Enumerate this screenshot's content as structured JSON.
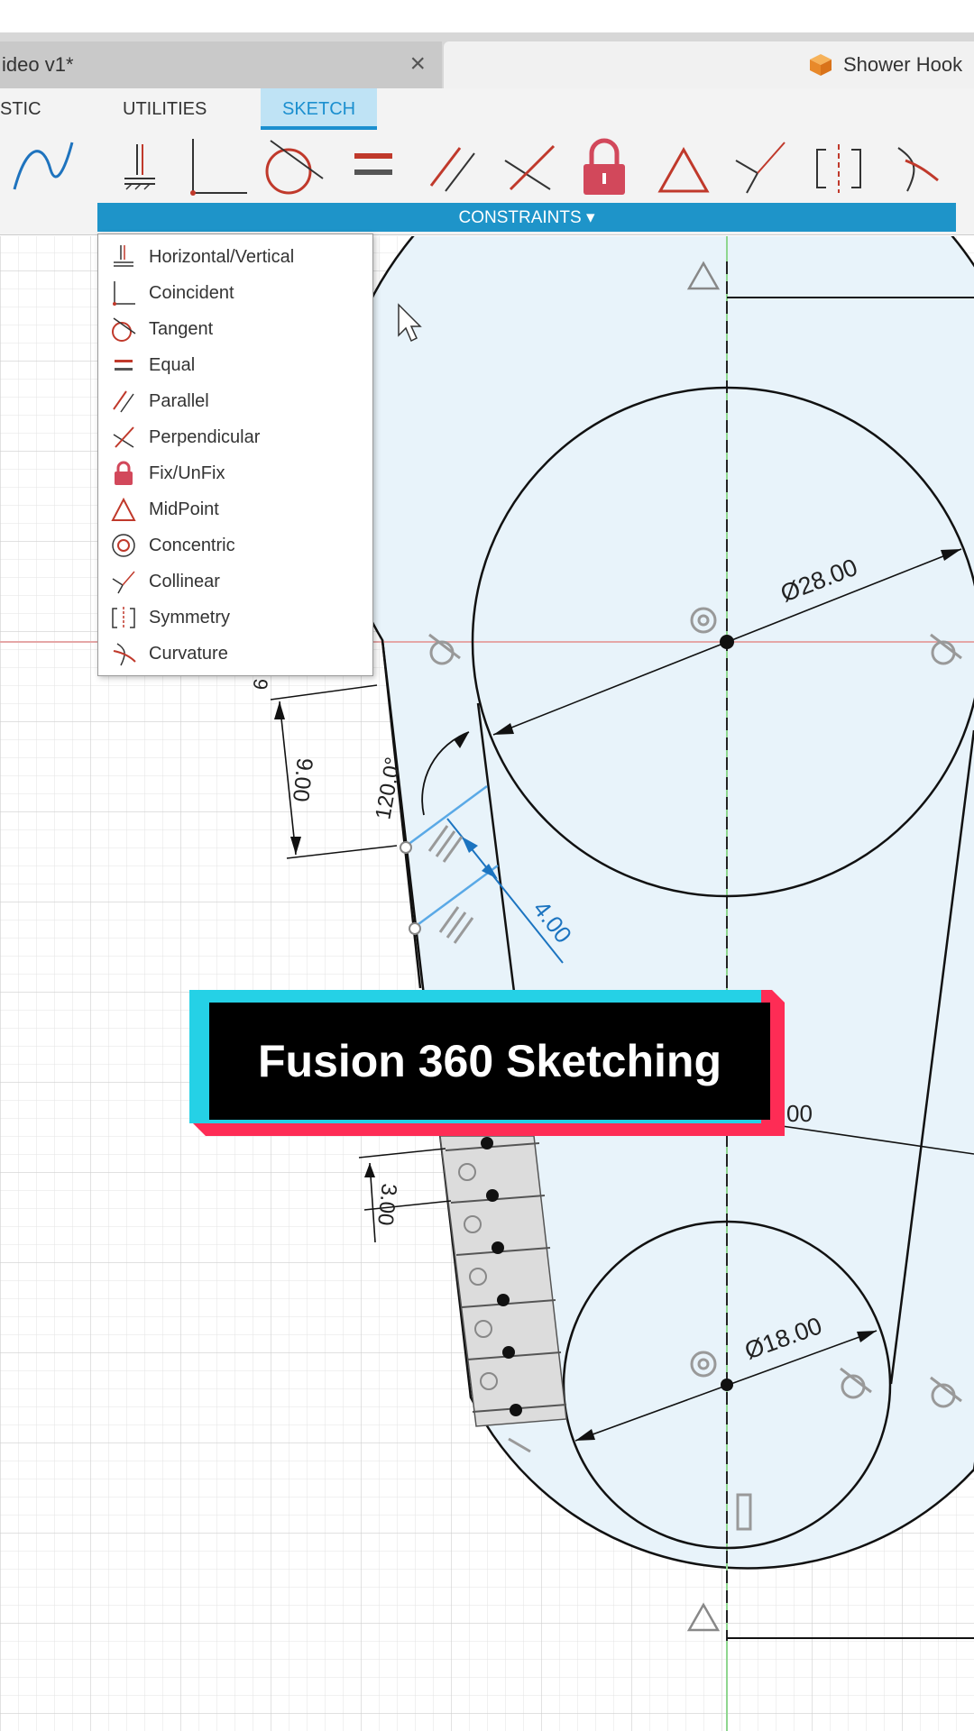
{
  "tabs": {
    "left_label": "ideo v1*",
    "close_glyph": "×",
    "right_label": "Shower Hook"
  },
  "menu": {
    "items": [
      "STIC",
      "UTILITIES",
      "SKETCH"
    ]
  },
  "constraints_bar": {
    "label": "CONSTRAINTS ▾"
  },
  "dropdown": {
    "items": [
      {
        "label": "Horizontal/Vertical",
        "icon": "horizontal-vertical-icon"
      },
      {
        "label": "Coincident",
        "icon": "coincident-icon"
      },
      {
        "label": "Tangent",
        "icon": "tangent-icon"
      },
      {
        "label": "Equal",
        "icon": "equal-icon"
      },
      {
        "label": "Parallel",
        "icon": "parallel-icon"
      },
      {
        "label": "Perpendicular",
        "icon": "perpendicular-icon"
      },
      {
        "label": "Fix/UnFix",
        "icon": "lock-icon"
      },
      {
        "label": "MidPoint",
        "icon": "midpoint-icon"
      },
      {
        "label": "Concentric",
        "icon": "concentric-icon"
      },
      {
        "label": "Collinear",
        "icon": "collinear-icon"
      },
      {
        "label": "Symmetry",
        "icon": "symmetry-icon"
      },
      {
        "label": "Curvature",
        "icon": "curvature-icon"
      }
    ]
  },
  "dimensions": {
    "large_diameter": "Ø28.00",
    "small_diameter": "Ø18.00",
    "vertical_a": "9.00",
    "angle": "120.0°",
    "offset": "4.00",
    "vertical_b": "3.00",
    "partial_dim": "00",
    "partial_left": "9"
  },
  "banner": {
    "title": "Fusion 360 Sketching"
  },
  "colors": {
    "accent": "#1e94c9",
    "sketch_fill": "#e8f3fa",
    "banner_cyan": "#25d1e6",
    "banner_red": "#fe2c55",
    "lock_red": "#d2485b"
  }
}
